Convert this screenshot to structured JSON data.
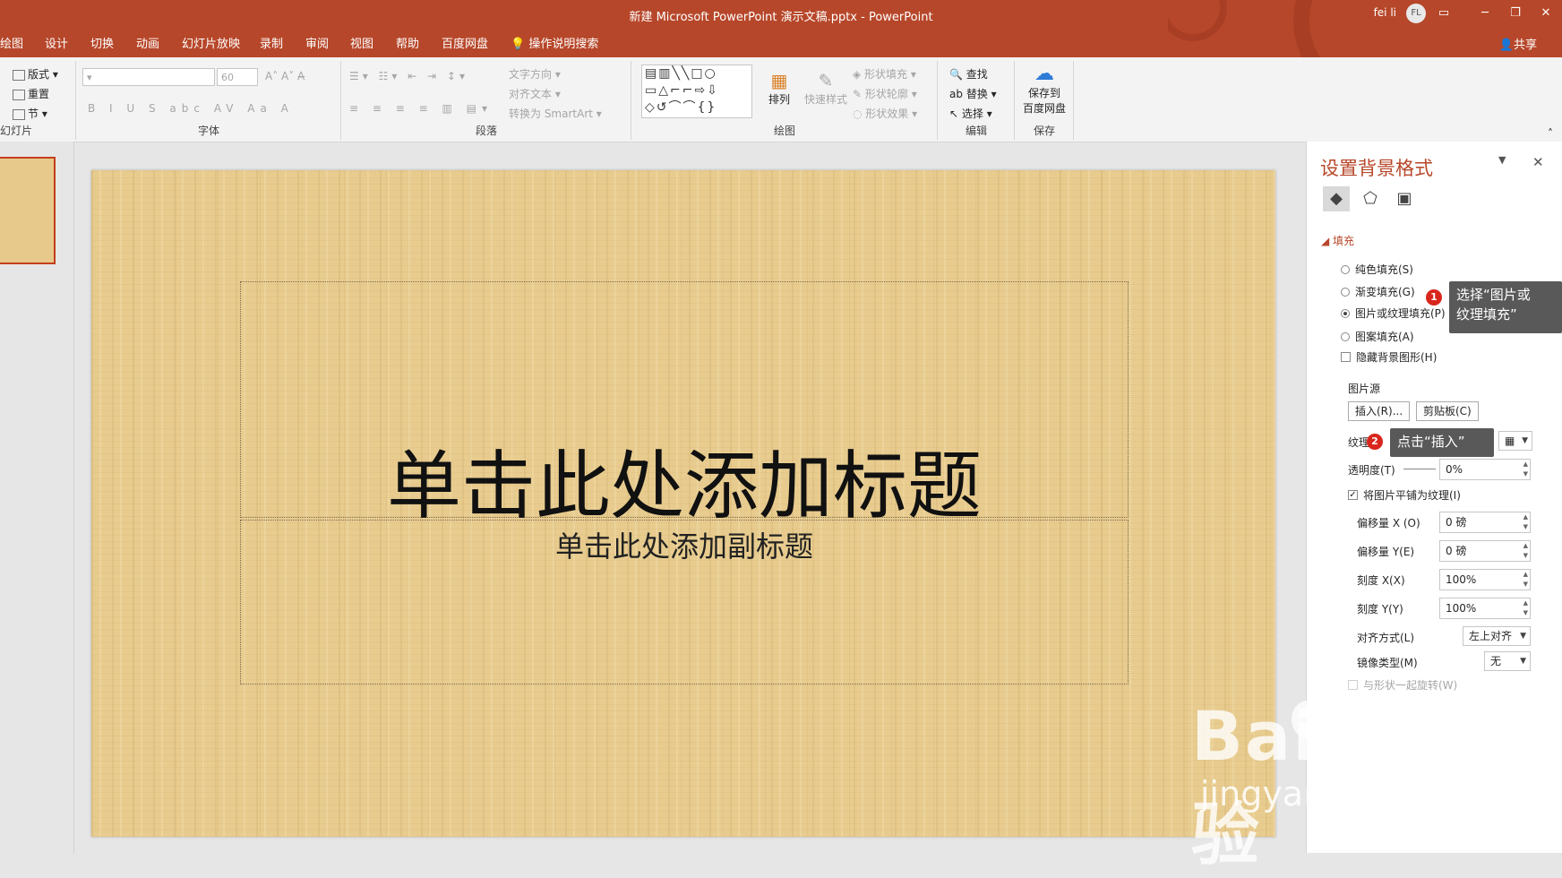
{
  "window": {
    "title": "新建 Microsoft PowerPoint 演示文稿.pptx  -  PowerPoint",
    "user": "fei li",
    "avatar_initials": "FL"
  },
  "tabs": [
    "绘图",
    "设计",
    "切换",
    "动画",
    "幻灯片放映",
    "录制",
    "审阅",
    "视图",
    "帮助",
    "百度网盘"
  ],
  "tell_me": "操作说明搜索",
  "share": "共享",
  "ribbon": {
    "slides": {
      "layout": "版式",
      "reset": "重置",
      "section": "节",
      "label": "幻灯片"
    },
    "font": {
      "size": "60",
      "label": "字体",
      "format_buttons": [
        "B",
        "I",
        "U",
        "S",
        "abc",
        "AV",
        "Aa"
      ]
    },
    "paragraph": {
      "text_direction": "文字方向",
      "align_text": "对齐文本",
      "smartart": "转换为 SmartArt",
      "label": "段落"
    },
    "drawing": {
      "arrange": "排列",
      "quick_styles": "快速样式",
      "shape_fill": "形状填充",
      "shape_outline": "形状轮廓",
      "shape_effects": "形状效果",
      "label": "绘图"
    },
    "editing": {
      "find": "查找",
      "replace": "替换",
      "select": "选择",
      "label": "编辑"
    },
    "save": {
      "save_to": "保存到",
      "baidu": "百度网盘",
      "label": "保存"
    }
  },
  "slide": {
    "title_placeholder": "单击此处添加标题",
    "subtitle_placeholder": "单击此处添加副标题"
  },
  "pane": {
    "title": "设置背景格式",
    "section": "填充",
    "fill_options": [
      {
        "label": "纯色填充(S)",
        "selected": false
      },
      {
        "label": "渐变填充(G)",
        "selected": false
      },
      {
        "label": "图片或纹理填充(P)",
        "selected": true
      },
      {
        "label": "图案填充(A)",
        "selected": false
      }
    ],
    "hide_bg": "隐藏背景图形(H)",
    "picture_source": "图片源",
    "insert_btn": "插入(R)...",
    "clipboard_btn": "剪贴板(C)",
    "texture_label": "纹理",
    "transparency_label": "透明度(T)",
    "transparency": "0%",
    "tile": "将图片平铺为纹理(I)",
    "offset_x_label": "偏移量 X (O)",
    "offset_x": "0 磅",
    "offset_y_label": "偏移量 Y(E)",
    "offset_y": "0 磅",
    "scale_x_label": "刻度 X(X)",
    "scale_x": "100%",
    "scale_y_label": "刻度 Y(Y)",
    "scale_y": "100%",
    "align_label": "对齐方式(L)",
    "align": "左上对齐",
    "mirror_label": "镜像类型(M)",
    "mirror": "无",
    "rotate_with_shape": "与形状一起旋转(W)"
  },
  "callouts": {
    "one_num": "1",
    "one_text_line1": "选择“图片或",
    "one_text_line2": "纹理填充”",
    "two_num": "2",
    "two_text": "点击“插入”"
  },
  "watermark": {
    "main": "Baidu经验",
    "url": "jingyan.baidu.com"
  }
}
